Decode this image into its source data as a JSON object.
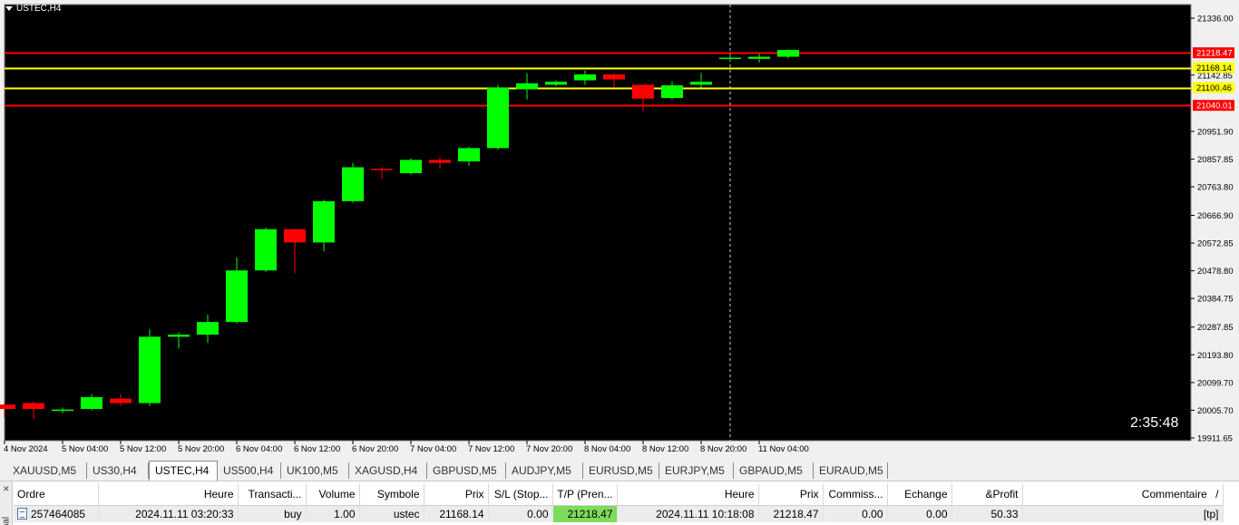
{
  "chart": {
    "symbol_label": "USTEC,H4",
    "countdown": "2:35:48",
    "colors": {
      "background": "#000000",
      "bull": "#00ff00",
      "bear": "#ff0000",
      "axis_text": "#000000",
      "red_level": "#ff0000",
      "yellow_level": "#ffff00"
    }
  },
  "chart_data": {
    "type": "candlestick",
    "ylim": [
      19911.65,
      21336.0
    ],
    "y_ticks": [
      "21336.00",
      "21142.85",
      "20951.90",
      "20857.85",
      "20763.80",
      "20666.90",
      "20572.85",
      "20478.80",
      "20384.75",
      "20287.85",
      "20193.80",
      "20099.70",
      "20005.70",
      "19911.65"
    ],
    "x_ticks": [
      "4 Nov 2024",
      "5 Nov 04:00",
      "5 Nov 12:00",
      "5 Nov 20:00",
      "6 Nov 04:00",
      "6 Nov 12:00",
      "6 Nov 20:00",
      "7 Nov 04:00",
      "7 Nov 12:00",
      "7 Nov 20:00",
      "8 Nov 04:00",
      "8 Nov 12:00",
      "8 Nov 20:00",
      "11 Nov 04:00"
    ],
    "vertical_marker_index": 25,
    "levels": [
      {
        "value": 21218.47,
        "label": "21218.47",
        "color": "#ff0000"
      },
      {
        "value": 21168.14,
        "label": "21168.14",
        "color": "#ffff00"
      },
      {
        "value": 21100.46,
        "label": "21100.46",
        "color": "#ffff00"
      },
      {
        "value": 21040.01,
        "label": "21040.01",
        "color": "#ff0000"
      }
    ],
    "candles": [
      {
        "o": 20025,
        "h": 20030,
        "l": 19980,
        "c": 20010
      },
      {
        "o": 20030,
        "h": 20035,
        "l": 19975,
        "c": 20010
      },
      {
        "o": 20005,
        "h": 20015,
        "l": 19995,
        "c": 20008
      },
      {
        "o": 20010,
        "h": 20060,
        "l": 20005,
        "c": 20050
      },
      {
        "o": 20045,
        "h": 20060,
        "l": 20020,
        "c": 20030
      },
      {
        "o": 20030,
        "h": 20280,
        "l": 20020,
        "c": 20255
      },
      {
        "o": 20255,
        "h": 20270,
        "l": 20215,
        "c": 20262
      },
      {
        "o": 20262,
        "h": 20330,
        "l": 20235,
        "c": 20305
      },
      {
        "o": 20305,
        "h": 20525,
        "l": 20300,
        "c": 20480
      },
      {
        "o": 20480,
        "h": 20625,
        "l": 20475,
        "c": 20620
      },
      {
        "o": 20620,
        "h": 20622,
        "l": 20470,
        "c": 20575
      },
      {
        "o": 20575,
        "h": 20720,
        "l": 20545,
        "c": 20715
      },
      {
        "o": 20715,
        "h": 20845,
        "l": 20710,
        "c": 20830
      },
      {
        "o": 20825,
        "h": 20832,
        "l": 20790,
        "c": 20822
      },
      {
        "o": 20810,
        "h": 20860,
        "l": 20805,
        "c": 20855
      },
      {
        "o": 20855,
        "h": 20865,
        "l": 20825,
        "c": 20845
      },
      {
        "o": 20850,
        "h": 20900,
        "l": 20835,
        "c": 20895
      },
      {
        "o": 20895,
        "h": 21110,
        "l": 20890,
        "c": 21100
      },
      {
        "o": 21095,
        "h": 21150,
        "l": 21060,
        "c": 21115
      },
      {
        "o": 21110,
        "h": 21125,
        "l": 21105,
        "c": 21120
      },
      {
        "o": 21125,
        "h": 21158,
        "l": 21110,
        "c": 21145
      },
      {
        "o": 21145,
        "h": 21150,
        "l": 21100,
        "c": 21128
      },
      {
        "o": 21110,
        "h": 21110,
        "l": 21020,
        "c": 21063
      },
      {
        "o": 21065,
        "h": 21122,
        "l": 21060,
        "c": 21108
      },
      {
        "o": 21110,
        "h": 21150,
        "l": 21100,
        "c": 21120
      },
      {
        "o": 21200,
        "h": 21215,
        "l": 21190,
        "c": 21202
      },
      {
        "o": 21198,
        "h": 21215,
        "l": 21185,
        "c": 21205
      },
      {
        "o": 21205,
        "h": 21230,
        "l": 21200,
        "c": 21228
      }
    ]
  },
  "tabs": [
    {
      "label": "XAUUSD,M5",
      "active": false
    },
    {
      "label": "US30,H4",
      "active": false
    },
    {
      "label": "USTEC,H4",
      "active": true
    },
    {
      "label": "US500,H4",
      "active": false
    },
    {
      "label": "UK100,M5",
      "active": false
    },
    {
      "label": "XAGUSD,H4",
      "active": false
    },
    {
      "label": "GBPUSD,M5",
      "active": false
    },
    {
      "label": "AUDJPY,M5",
      "active": false
    },
    {
      "label": "EURUSD,M5",
      "active": false
    },
    {
      "label": "EURJPY,M5",
      "active": false
    },
    {
      "label": "GBPAUD,M5",
      "active": false
    },
    {
      "label": "EURAUD,M5",
      "active": false
    }
  ],
  "terminal": {
    "side_label": "inal",
    "columns": [
      "Ordre",
      "Heure",
      "Transacti...",
      "Volume",
      "Symbole",
      "Prix",
      "S/L (Stop...",
      "T/P (Pren...",
      "Heure",
      "Prix",
      "Commiss...",
      "Echange",
      "&Profit",
      "Commentaire"
    ],
    "rows": [
      {
        "order": "257464085",
        "open_time": "2024.11.11 03:20:33",
        "type": "buy",
        "volume": "1.00",
        "symbol": "ustec",
        "open_price": "21168.14",
        "sl": "0.00",
        "tp": "21218.47",
        "close_time": "2024.11.11 10:18:08",
        "close_price": "21218.47",
        "commission": "0.00",
        "swap": "0.00",
        "profit": "50.33",
        "comment": "[tp]"
      }
    ]
  }
}
